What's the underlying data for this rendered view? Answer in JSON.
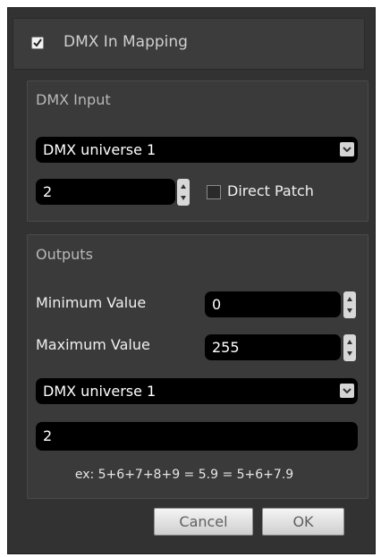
{
  "dialog": {
    "enable_checkbox_checked": true,
    "title": "DMX In Mapping"
  },
  "dmx_input": {
    "group_title": "DMX Input",
    "universe": "DMX universe 1",
    "channel": "2",
    "direct_patch_label": "Direct Patch",
    "direct_patch_checked": false
  },
  "outputs": {
    "group_title": "Outputs",
    "min_label": "Minimum Value",
    "min_value": "0",
    "max_label": "Maximum Value",
    "max_value": "255",
    "universe": "DMX universe 1",
    "channels": "2",
    "hint": "ex: 5+6+7+8+9 = 5.9 = 5+6+7.9"
  },
  "buttons": {
    "cancel": "Cancel",
    "ok": "OK"
  },
  "icons": {
    "checkbox": "checkmark-icon",
    "dropdown": "chevron-down-icon",
    "spinner": "spinner-arrows-icon"
  }
}
